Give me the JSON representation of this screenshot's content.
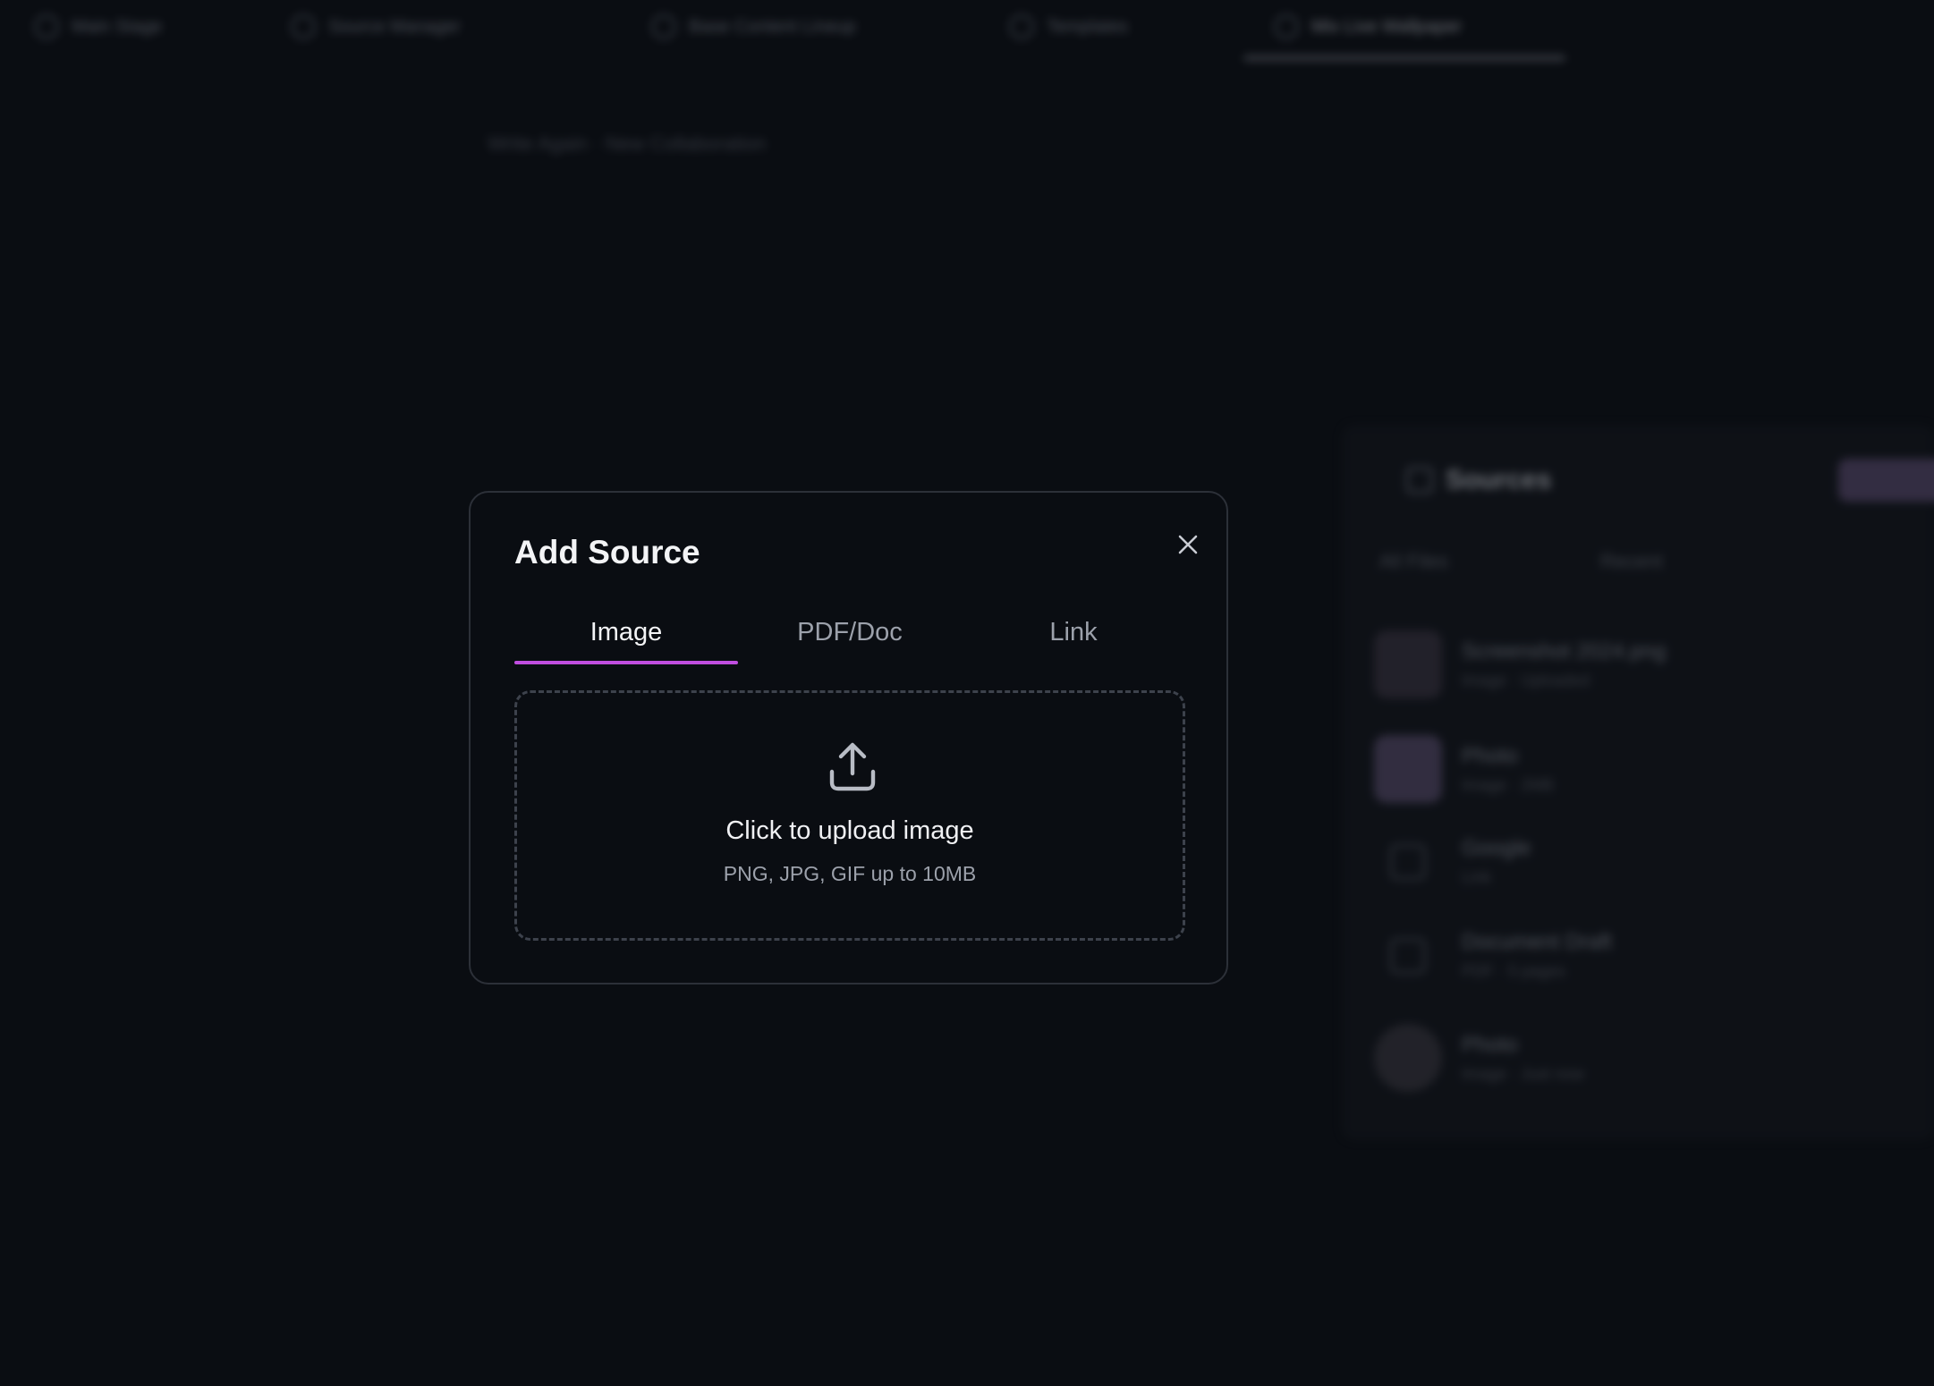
{
  "background": {
    "top_tabs": [
      {
        "label": "Main Stage"
      },
      {
        "label": "Source Manager"
      },
      {
        "label": "Base Content Lineup"
      },
      {
        "label": "Templates"
      },
      {
        "label": "Mix Live Wallpaper"
      }
    ],
    "breadcrumb": "Write Again · New Collaboration",
    "sources_panel": {
      "title": "Sources",
      "filter_left": "All Files",
      "filter_right": "Recent",
      "items": [
        {
          "name": "Screenshot 2024.png",
          "meta": "Image · Uploaded"
        },
        {
          "name": "Photo",
          "meta": "Image · 2MB"
        },
        {
          "name": "Google",
          "meta": "Link"
        },
        {
          "name": "Document Draft",
          "meta": "PDF · 5 pages"
        },
        {
          "name": "Photo",
          "meta": "Image · Just now"
        }
      ]
    }
  },
  "modal": {
    "title": "Add Source",
    "close_icon": "close-icon",
    "tabs": [
      {
        "label": "Image",
        "active": true
      },
      {
        "label": "PDF/Doc",
        "active": false
      },
      {
        "label": "Link",
        "active": false
      }
    ],
    "dropzone": {
      "icon": "upload-icon",
      "title": "Click to upload image",
      "subtitle": "PNG, JPG, GIF up to 10MB"
    }
  },
  "colors": {
    "background": "#0a0d12",
    "modal_border": "#2c3038",
    "accent": "#c04ee0",
    "text_primary": "#f3f4f6",
    "text_secondary": "#9ca1ab"
  }
}
